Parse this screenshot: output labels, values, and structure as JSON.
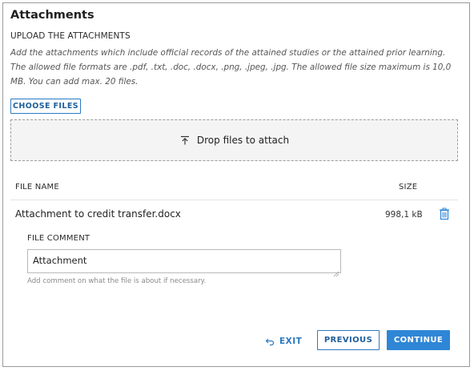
{
  "section": {
    "title": "Attachments",
    "upload_heading": "UPLOAD THE ATTACHMENTS",
    "help_text": "Add the attachments which include official records of the attained studies or the attained prior learning. The allowed file formats are .pdf, .txt, .doc, .docx, .png, .jpeg, .jpg. The allowed file size maximum is 10,0 MB. You can add max. 20 files."
  },
  "upload": {
    "choose_label": "CHOOSE FILES",
    "drop_label": "Drop files to attach",
    "drop_icon": "upload-arrow-icon"
  },
  "table": {
    "headers": {
      "file_name": "FILE NAME",
      "size": "SIZE"
    },
    "files": [
      {
        "name": "Attachment to credit transfer.docx",
        "size": "998,1 kB",
        "delete_icon": "trash-icon",
        "comment_label": "FILE COMMENT",
        "comment_value": "Attachment",
        "comment_hint": "Add comment on what the file is about if necessary."
      }
    ]
  },
  "actions": {
    "exit_label": "EXIT",
    "exit_icon": "exit-arrow-icon",
    "previous_label": "PREVIOUS",
    "continue_label": "CONTINUE"
  },
  "colors": {
    "accent": "#2f86d6",
    "accent_dark": "#1f5e9e",
    "border": "#9a9a9a",
    "dropzone_bg": "#f4f4f4"
  }
}
